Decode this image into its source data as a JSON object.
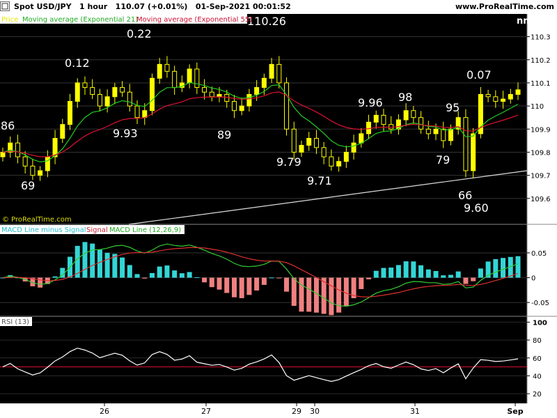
{
  "header": {
    "title": "Spot USD/JPY   1 hour   110.07 (+0.01%)   01-Sep-2021 00:01:52",
    "site": "www.ProRealTime.com",
    "toggle_icon": "chart-toggle-icon"
  },
  "watermark": "© ProRealTime.com",
  "price_legend": {
    "price": "Price",
    "ema21": "Moving average (Exponential 21)",
    "ema55": "Moving average (Exponential 55)",
    "corner": "nn"
  },
  "macd_legend": {
    "hist": "MACD Line minus Signal",
    "signal": "Signal",
    "line": "MACD Line (12,26,9)"
  },
  "rsi_legend": "RSI (13)",
  "colors": {
    "background": "#000000",
    "candle": "#ffff00",
    "ema21": "#22cc22",
    "ema55": "#dd1133",
    "hist_pos": "#33d6d6",
    "hist_neg": "#f08080",
    "macd_line": "#33cc33",
    "signal_line": "#e03030",
    "rsi_line": "#ffffff",
    "rsi_ref": "#dd1133",
    "trendline": "#dddddd"
  },
  "chart_data": [
    {
      "type": "candlestick",
      "panel": "price",
      "ylim": [
        109.5,
        110.35
      ],
      "yticks": [
        "110.3",
        "110.2",
        "110.1",
        "110",
        "109.9",
        "109.8",
        "109.7",
        "109.6"
      ],
      "close": [
        109.8,
        109.84,
        109.78,
        109.74,
        109.7,
        109.72,
        109.78,
        109.86,
        109.92,
        110.02,
        110.1,
        110.08,
        110.05,
        110.0,
        110.04,
        110.08,
        110.06,
        110.0,
        109.95,
        109.98,
        110.12,
        110.18,
        110.15,
        110.08,
        110.1,
        110.16,
        110.08,
        110.06,
        110.04,
        110.05,
        110.02,
        109.98,
        110.0,
        110.05,
        110.08,
        110.12,
        110.18,
        110.1,
        109.9,
        109.8,
        109.83,
        109.86,
        109.82,
        109.78,
        109.74,
        109.76,
        109.8,
        109.84,
        109.88,
        109.93,
        109.96,
        109.92,
        109.9,
        109.94,
        109.98,
        109.95,
        109.9,
        109.88,
        109.9,
        109.85,
        109.9,
        109.95,
        109.72,
        109.88,
        110.05,
        110.04,
        110.02,
        110.03,
        110.05,
        110.07
      ],
      "annotations": [
        {
          "text": "86",
          "role": "price-low"
        },
        {
          "text": "69",
          "role": "price-low"
        },
        {
          "text": "0.12",
          "role": "price-high"
        },
        {
          "text": "9.93",
          "role": "price-low"
        },
        {
          "text": "0.22",
          "role": "price-high"
        },
        {
          "text": "89",
          "role": "price-low"
        },
        {
          "text": "110.26",
          "role": "price-high"
        },
        {
          "text": "9.79",
          "role": "price-low"
        },
        {
          "text": "9.71",
          "role": "price-low"
        },
        {
          "text": "9.96",
          "role": "price-high"
        },
        {
          "text": "98",
          "role": "price-high"
        },
        {
          "text": "79",
          "role": "price-low"
        },
        {
          "text": "95",
          "role": "price-high"
        },
        {
          "text": "66",
          "role": "price-low"
        },
        {
          "text": "9.60",
          "role": "price-low"
        },
        {
          "text": "0.07",
          "role": "price-high"
        }
      ],
      "series": [
        {
          "name": "Moving average (Exponential 21)"
        },
        {
          "name": "Moving average (Exponential 55)"
        }
      ]
    },
    {
      "type": "bar",
      "panel": "macd",
      "ylim": [
        -0.075,
        0.085
      ],
      "yticks": [
        "0.05",
        "0",
        "-0.05"
      ],
      "series": [
        {
          "name": "MACD Line minus Signal"
        },
        {
          "name": "Signal"
        },
        {
          "name": "MACD Line (12,26,9)"
        }
      ]
    },
    {
      "type": "line",
      "panel": "rsi",
      "ylim": [
        10,
        105
      ],
      "yticks": [
        "100",
        "80",
        "60",
        "40",
        "20"
      ],
      "reference": 50,
      "series": [
        {
          "name": "RSI (13)"
        }
      ]
    }
  ],
  "x_axis": {
    "labels": [
      "26",
      "27",
      "29",
      "30",
      "31",
      "Sep"
    ]
  }
}
